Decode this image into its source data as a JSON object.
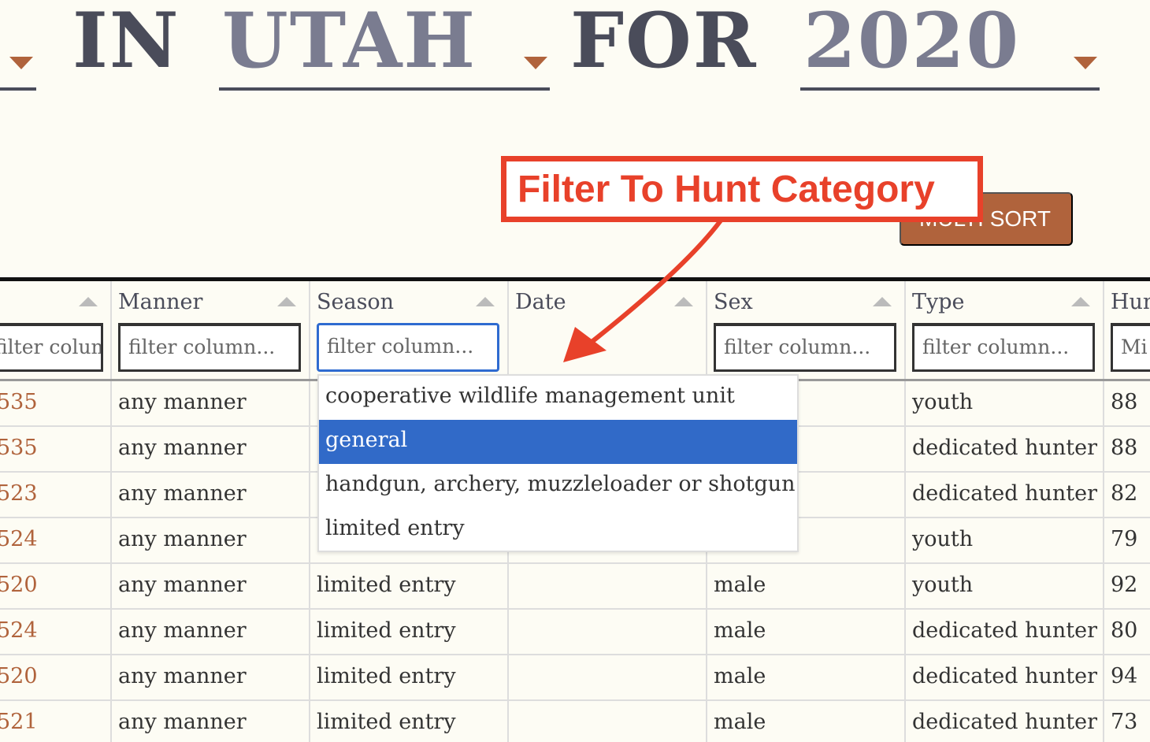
{
  "title": {
    "words": [
      "IN",
      "UTAH",
      "FOR",
      "2020"
    ]
  },
  "multi_sort_label": "MULTI SORT",
  "annotation": {
    "text": "Filter To Hunt Category",
    "color": "#e8412a"
  },
  "colors": {
    "accent": "#b0633c",
    "selected": "#316ac8"
  },
  "table": {
    "columns": [
      {
        "label": "",
        "filter": "filter column..."
      },
      {
        "label": "Manner",
        "filter": "filter column..."
      },
      {
        "label": "Season",
        "filter": "filter column..."
      },
      {
        "label": "Date",
        "filter": ""
      },
      {
        "label": "Sex",
        "filter": "filter column..."
      },
      {
        "label": "Type",
        "filter": "filter column..."
      },
      {
        "label": "Hun",
        "filter": "Mi"
      }
    ],
    "rows": [
      {
        "unit": "535",
        "manner": "any manner",
        "season": "",
        "sex": "",
        "type": "youth",
        "num": "88"
      },
      {
        "unit": "535",
        "manner": "any manner",
        "season": "",
        "sex": "",
        "type": "dedicated hunter",
        "num": "88"
      },
      {
        "unit": "523",
        "manner": "any manner",
        "season": "",
        "sex": "",
        "type": "dedicated hunter",
        "num": "82"
      },
      {
        "unit": "524",
        "manner": "any manner",
        "season": "",
        "sex": "",
        "type": "youth",
        "num": "79"
      },
      {
        "unit": "520",
        "manner": "any manner",
        "season": "limited entry",
        "sex": "male",
        "type": "youth",
        "num": "92"
      },
      {
        "unit": "524",
        "manner": "any manner",
        "season": "limited entry",
        "sex": "male",
        "type": "dedicated hunter",
        "num": "80"
      },
      {
        "unit": "520",
        "manner": "any manner",
        "season": "limited entry",
        "sex": "male",
        "type": "dedicated hunter",
        "num": "94"
      },
      {
        "unit": "521",
        "manner": "any manner",
        "season": "limited entry",
        "sex": "male",
        "type": "dedicated hunter",
        "num": "73"
      }
    ]
  },
  "season_dropdown": {
    "options": [
      "cooperative wildlife management unit",
      "general",
      "handgun, archery, muzzleloader or shotgun",
      "limited entry"
    ],
    "highlighted": "general"
  }
}
